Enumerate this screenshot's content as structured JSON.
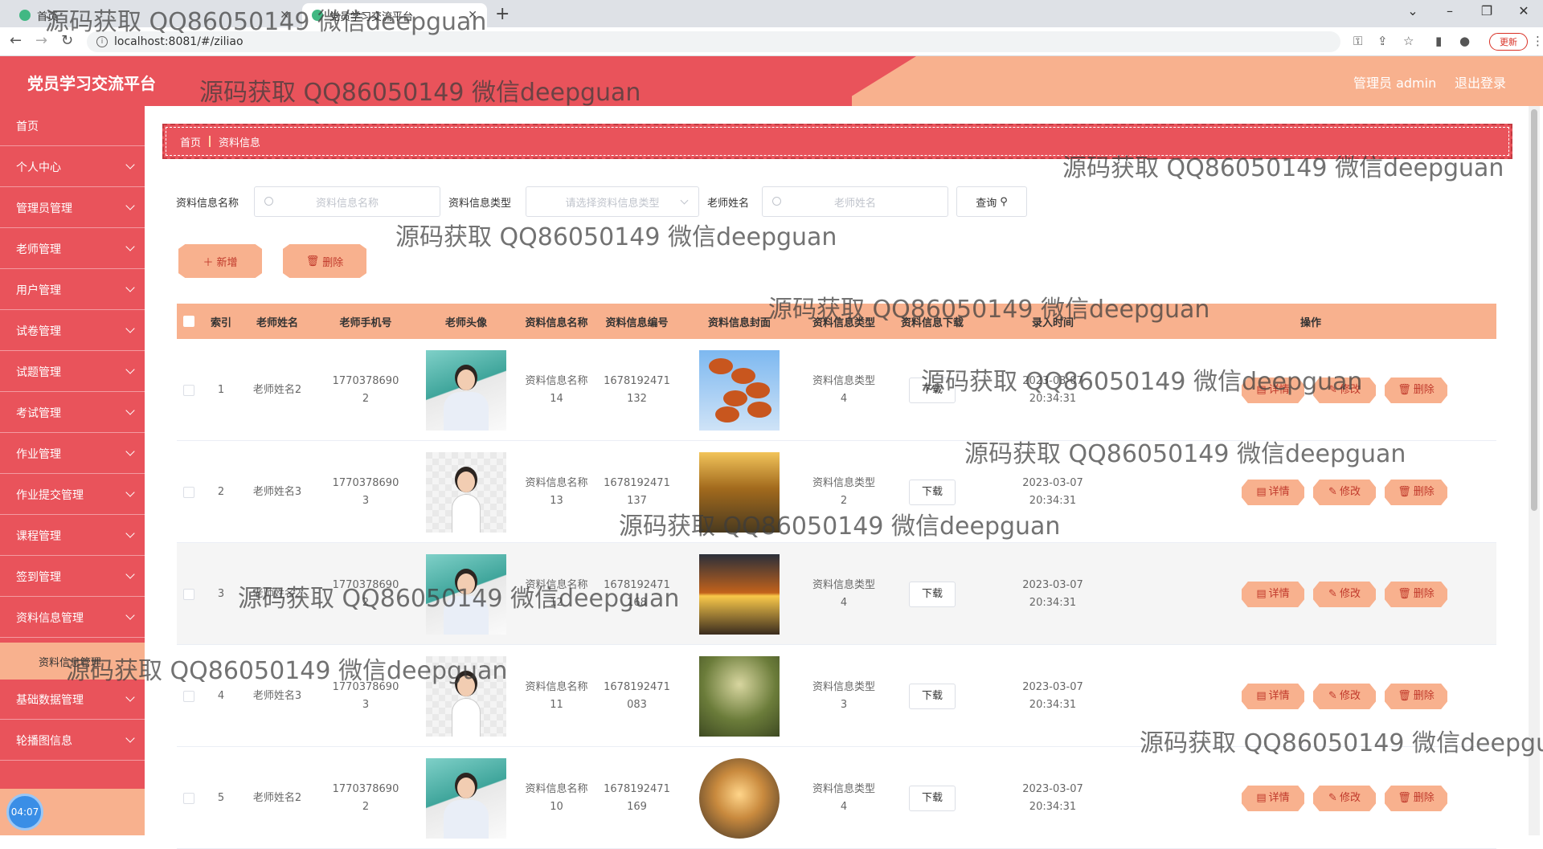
{
  "browser": {
    "tabs": [
      {
        "title": "首页",
        "active": false
      },
      {
        "title": "党员学习交流平台",
        "active": true
      }
    ],
    "new_tab": "+",
    "url": "localhost:8081/#/ziliao",
    "update_label": "更新",
    "window_controls": {
      "dropdown": "⌄",
      "minimize": "–",
      "restore": "❐",
      "close": "✕"
    }
  },
  "header": {
    "app_title": "党员学习交流平台",
    "user_label": "管理员 admin",
    "logout_label": "退出登录"
  },
  "sidebar": {
    "items": [
      {
        "label": "首页",
        "expandable": false
      },
      {
        "label": "个人中心",
        "expandable": true
      },
      {
        "label": "管理员管理",
        "expandable": true
      },
      {
        "label": "老师管理",
        "expandable": true
      },
      {
        "label": "用户管理",
        "expandable": true
      },
      {
        "label": "试卷管理",
        "expandable": true
      },
      {
        "label": "试题管理",
        "expandable": true
      },
      {
        "label": "考试管理",
        "expandable": true
      },
      {
        "label": "作业管理",
        "expandable": true
      },
      {
        "label": "作业提交管理",
        "expandable": true
      },
      {
        "label": "课程管理",
        "expandable": true
      },
      {
        "label": "签到管理",
        "expandable": true
      },
      {
        "label": "资料信息管理",
        "expandable": true
      }
    ],
    "active_submenu": "资料信息管理",
    "items_after": [
      {
        "label": "基础数据管理",
        "expandable": true
      },
      {
        "label": "轮播图信息",
        "expandable": true
      }
    ],
    "clock": "04:07"
  },
  "breadcrumb": {
    "home": "首页",
    "current": "资料信息"
  },
  "search": {
    "name_label": "资料信息名称",
    "name_placeholder": "资料信息名称",
    "type_label": "资料信息类型",
    "type_placeholder": "请选择资料信息类型",
    "teacher_label": "老师姓名",
    "teacher_placeholder": "老师姓名",
    "query_label": "查询"
  },
  "actions": {
    "add_label": "新增",
    "delete_label": "删除"
  },
  "table": {
    "columns": [
      "",
      "索引",
      "老师姓名",
      "老师手机号",
      "老师头像",
      "资料信息名称",
      "资料信息编号",
      "资料信息封面",
      "资料信息类型",
      "资料信息下载",
      "录入时间",
      "操作"
    ],
    "download_label": "下载",
    "detail_label": "详情",
    "edit_label": "修改",
    "remove_label": "删除",
    "rows": [
      {
        "index": "1",
        "teacher": "老师姓名2",
        "phone_1": "1770378690",
        "phone_2": "2",
        "name_1": "资料信息名称",
        "name_2": "14",
        "code_1": "1678192471",
        "code_2": "132",
        "type_1": "资料信息类型",
        "type_2": "4",
        "date": "2023-03-07",
        "time": "20:34:31",
        "avatar": "a2",
        "cover": "c1"
      },
      {
        "index": "2",
        "teacher": "老师姓名3",
        "phone_1": "1770378690",
        "phone_2": "3",
        "name_1": "资料信息名称",
        "name_2": "13",
        "code_1": "1678192471",
        "code_2": "137",
        "type_1": "资料信息类型",
        "type_2": "2",
        "date": "2023-03-07",
        "time": "20:34:31",
        "avatar": "a3",
        "cover": "c2"
      },
      {
        "index": "3",
        "teacher": "老师姓名2",
        "phone_1": "1770378690",
        "phone_2": "2",
        "name_1": "资料信息名称",
        "name_2": "12",
        "code_1": "1678192471",
        "code_2": "168",
        "type_1": "资料信息类型",
        "type_2": "4",
        "date": "2023-03-07",
        "time": "20:34:31",
        "avatar": "a2",
        "cover": "c3"
      },
      {
        "index": "4",
        "teacher": "老师姓名3",
        "phone_1": "1770378690",
        "phone_2": "3",
        "name_1": "资料信息名称",
        "name_2": "11",
        "code_1": "1678192471",
        "code_2": "083",
        "type_1": "资料信息类型",
        "type_2": "3",
        "date": "2023-03-07",
        "time": "20:34:31",
        "avatar": "a3",
        "cover": "c4"
      },
      {
        "index": "5",
        "teacher": "老师姓名2",
        "phone_1": "1770378690",
        "phone_2": "2",
        "name_1": "资料信息名称",
        "name_2": "10",
        "code_1": "1678192471",
        "code_2": "169",
        "type_1": "资料信息类型",
        "type_2": "4",
        "date": "2023-03-07",
        "time": "20:34:31",
        "avatar": "a2",
        "cover": "c5"
      }
    ]
  },
  "watermark": "源码获取 QQ86050149 微信deepguan",
  "watermark_cut": "源码获取 QQ86050149 微信deepgu",
  "colors": {
    "primary": "#e9535b",
    "accent": "#f8b18e"
  }
}
